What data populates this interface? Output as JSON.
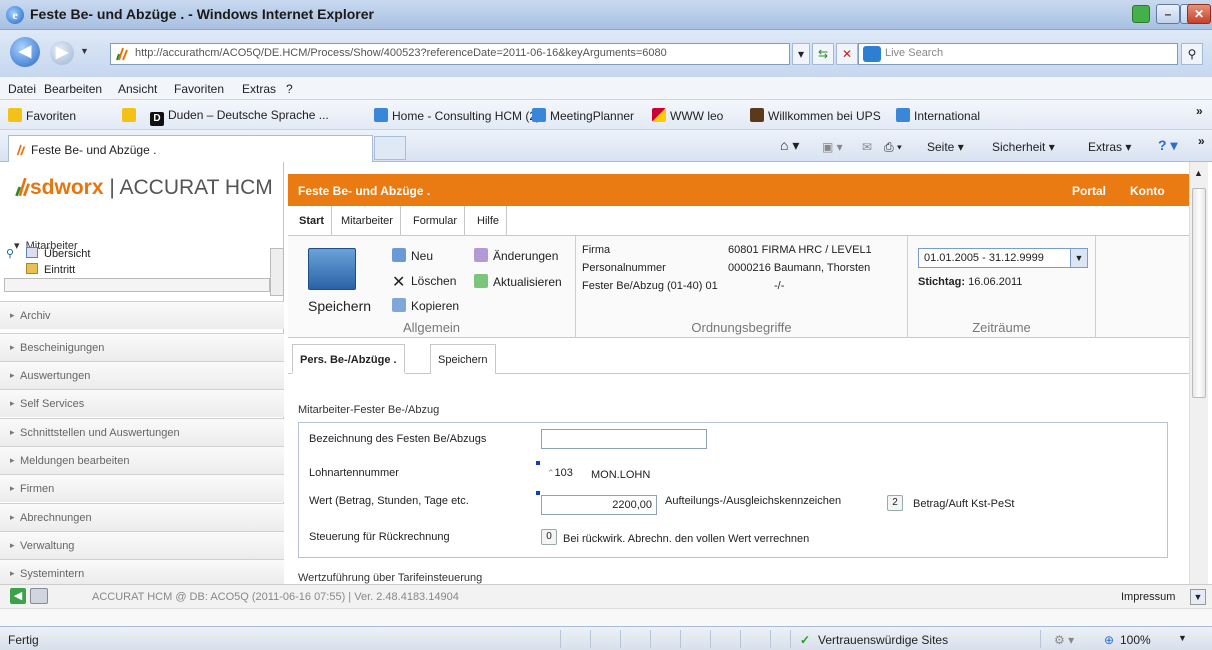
{
  "window": {
    "title": "Feste Be- und Abzüge . - Windows Internet Explorer"
  },
  "nav": {
    "address": "http://accurathcm/ACO5Q/DE.HCM/Process/Show/400523?referenceDate=2011-06-16&keyArguments=6080",
    "search_placeholder": "Live Search"
  },
  "menu": [
    "Datei",
    "Bearbeiten",
    "Ansicht",
    "Favoriten",
    "Extras",
    "?"
  ],
  "favorites": {
    "label": "Favoriten",
    "items": [
      "Duden – Deutsche Sprache ...",
      "Home - Consulting HCM (2)",
      "MeetingPlanner",
      "WWW leo",
      "Willkommen bei UPS",
      "International"
    ]
  },
  "browser_tab": {
    "label": "Feste Be- und Abzüge ."
  },
  "commandbar": {
    "page": "Seite",
    "security": "Sicherheit",
    "extras": "Extras"
  },
  "sidebar": {
    "logo_brand": "sdworx",
    "logo_product": "| ACCURAT HCM",
    "section": "Mitarbeiter",
    "tree": [
      "Übersicht",
      "Eintritt"
    ],
    "items": [
      "Archiv",
      "Bescheinigungen",
      "Auswertungen",
      "Self Services",
      "Schnittstellen und Auswertungen",
      "Meldungen bearbeiten",
      "Firmen",
      "Abrechnungen",
      "Verwaltung",
      "Systemintern"
    ]
  },
  "header": {
    "title": "Feste Be- und Abzüge .",
    "portal": "Portal",
    "konto": "Konto"
  },
  "ribbon_tabs": [
    "Start",
    "Mitarbeiter",
    "Formular",
    "Hilfe"
  ],
  "ribbon": {
    "save": "Speichern",
    "new": "Neu",
    "changes": "Änderungen",
    "delete": "Löschen",
    "refresh": "Aktualisieren",
    "copy": "Kopieren",
    "group_general": "Allgemein",
    "firma_label": "Firma",
    "firma_value": "60801   FIRMA HRC / LEVEL1",
    "persnr_label": "Personalnummer",
    "persnr_value": "0000216 Baumann, Thorsten",
    "fester_label": "Fester Be/Abzug (01-40) 01",
    "fester_value": "-/-",
    "group_ordnung": "Ordnungsbegriffe",
    "zeitraum": "01.01.2005 - 31.12.9999",
    "stichtag_label": "Stichtag:",
    "stichtag_value": "16.06.2011",
    "group_zeit": "Zeiträume"
  },
  "sub_tabs": [
    "Pers. Be-/Abzüge .",
    "Speichern"
  ],
  "form": {
    "title": "Mitarbeiter-Fester Be-/Abzug",
    "bezeichnung_label": "Bezeichnung des Festen Be/Abzugs",
    "bezeichnung_value": "",
    "lohnart_label": "Lohnartennummer",
    "lohnart_value": "103",
    "lohnart_text": "MON.LOHN",
    "wert_label": "Wert (Betrag, Stunden, Tage etc.",
    "wert_value": "2200,00",
    "aufteil_label": "Aufteilungs-/Ausgleichskennzeichen",
    "aufteil_value": "2",
    "aufteil_text": "Betrag/Auft Kst-PeSt",
    "steuerung_label": "Steuerung für Rückrechnung",
    "steuerung_value": "0",
    "steuerung_text": "Bei rückwirk. Abrechn. den vollen Wert verrechnen",
    "next_section": "Wertzuführung über Tarifeinsteuerung"
  },
  "footer": {
    "text": "ACCURAT HCM @ DB: ACO5Q (2011-06-16 07:55) | Ver. 2.48.4183.14904",
    "impressum": "Impressum"
  },
  "status": {
    "left": "Fertig",
    "zone": "Vertrauenswürdige Sites",
    "zoom": "100%"
  }
}
